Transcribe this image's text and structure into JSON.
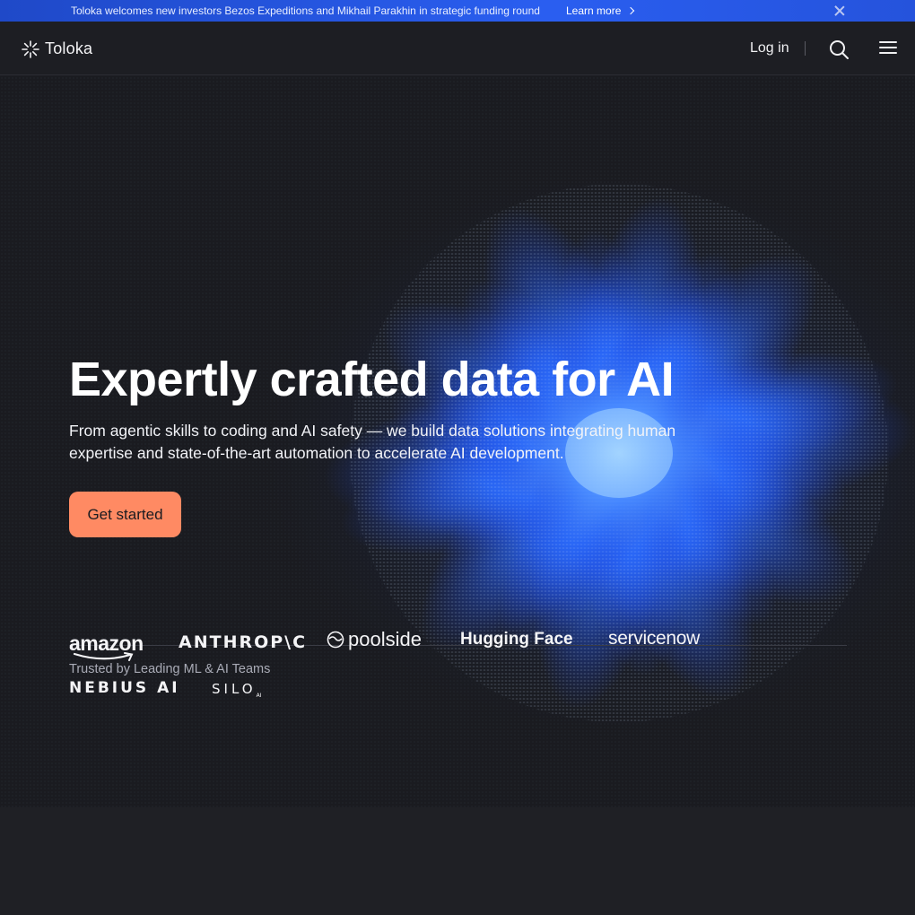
{
  "announcement": {
    "message": "Toloka welcomes new investors Bezos Expeditions and Mikhail Parakhin in strategic funding round",
    "link_label": "Learn more"
  },
  "nav": {
    "brand": "Toloka",
    "login_label": "Log in",
    "icons": [
      "toloka-logo-icon",
      "search-icon",
      "hamburger-menu-icon",
      "close-icon",
      "chevron-right-icon"
    ]
  },
  "hero": {
    "title": "Expertly crafted data for AI",
    "subtitle": "From agentic skills to coding and AI safety — we build data solutions integrating human expertise and state-of-the-art automation to accelerate AI development.",
    "cta_label": "Get started",
    "trusted_label": "Trusted by Leading ML & AI Teams"
  },
  "clients": {
    "amazon": "amazon",
    "anthropic": "ANTHROP\\C",
    "poolside": "poolside",
    "huggingface": "Hugging Face",
    "servicenow": "servicenow",
    "nebius": "NEBIUS AI",
    "silo": "SILO",
    "silo_suffix": "AI"
  },
  "colors": {
    "accent": "#ff8a63",
    "banner": "#2a5ef0",
    "background": "#1a1b20"
  }
}
